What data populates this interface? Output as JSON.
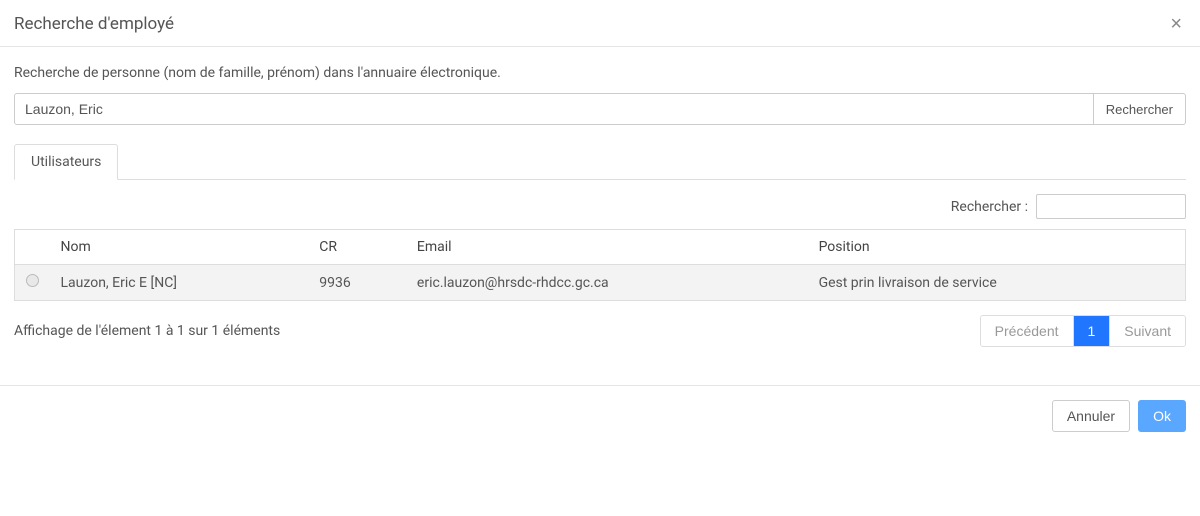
{
  "modal": {
    "title": "Recherche d'employé",
    "close_symbol": "×"
  },
  "search": {
    "label": "Recherche de personne (nom de famille, prénom) dans l'annuaire électronique.",
    "value": "Lauzon, Eric",
    "button": "Rechercher"
  },
  "tabs": {
    "users": "Utilisateurs"
  },
  "filter": {
    "label": "Rechercher :",
    "value": ""
  },
  "table": {
    "headers": {
      "name": "Nom",
      "cr": "CR",
      "email": "Email",
      "position": "Position"
    },
    "rows": [
      {
        "name": "Lauzon, Eric E [NC]",
        "cr": "9936",
        "email": "eric.lauzon@hrsdc-rhdcc.gc.ca",
        "position": "Gest prin livraison de service"
      }
    ]
  },
  "pagination": {
    "showing": "Affichage de l'élement 1 à 1 sur 1 éléments",
    "prev": "Précédent",
    "page1": "1",
    "next": "Suivant"
  },
  "footer": {
    "cancel": "Annuler",
    "ok": "Ok"
  }
}
